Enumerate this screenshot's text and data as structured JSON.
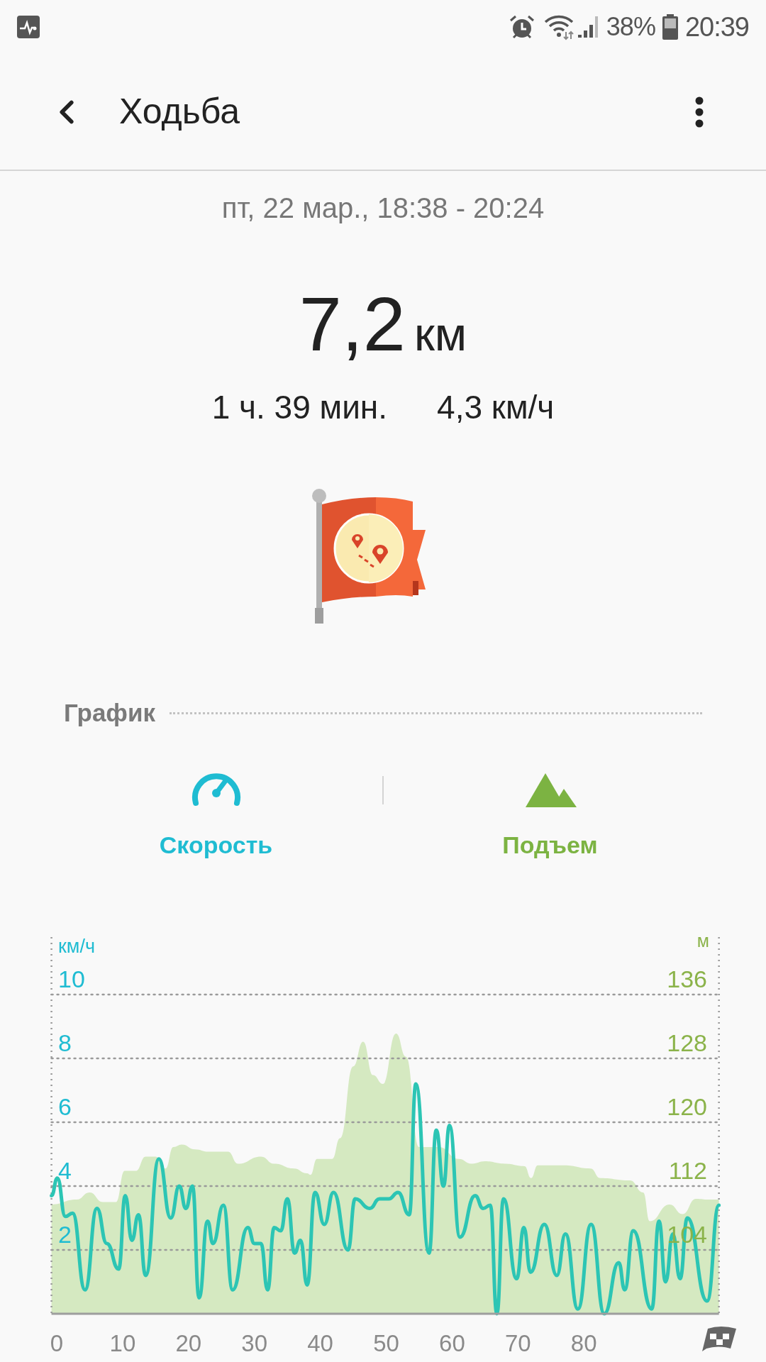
{
  "status_bar": {
    "battery": "38%",
    "time": "20:39"
  },
  "header": {
    "title": "Ходьба"
  },
  "workout": {
    "date": "пт, 22 мар., 18:38 - 20:24",
    "distance_value": "7,2",
    "distance_unit": "км",
    "duration": "1 ч. 39 мин.",
    "avg_speed": "4,3 км/ч"
  },
  "chart_section": {
    "title": "График",
    "toggles": [
      {
        "kind": "speed",
        "label": "Скорость",
        "color": "#1fbcd2"
      },
      {
        "kind": "elevation",
        "label": "Подъем",
        "color": "#7cb342"
      }
    ],
    "chart_data": {
      "type": "line",
      "grid": true,
      "ylabel": "км/ч",
      "y2label": "м",
      "xlim": [
        -0.8,
        100.5
      ],
      "ylim": [
        0,
        11.8
      ],
      "y2lim": [
        96,
        143.2
      ],
      "xticks": [
        0,
        10,
        20,
        30,
        40,
        50,
        60,
        70,
        80
      ],
      "yticks": [
        2,
        4,
        6,
        8,
        10
      ],
      "y2ticks": [
        104,
        112,
        120,
        128,
        136
      ],
      "series": [
        {
          "type": "area",
          "axis": "y2",
          "color": "#d5e9c1",
          "x": [
            -0.8,
            3,
            5,
            7,
            9,
            10.3,
            12,
            13.5,
            15,
            16.5,
            17.7,
            19,
            21,
            23,
            26,
            27.5,
            31,
            33,
            36,
            38,
            38.5,
            39.5,
            41.8,
            43,
            45,
            46.5,
            48,
            49.5,
            51.5,
            53,
            55,
            58,
            61,
            63,
            65,
            68,
            71,
            72,
            73,
            77,
            81,
            82.5,
            87,
            89,
            90,
            93,
            95,
            97,
            99,
            100.5
          ],
          "values": [
            109.7,
            110.3,
            111.2,
            110,
            110,
            113.9,
            113.9,
            115.7,
            115.7,
            114.2,
            116.9,
            117.2,
            116.6,
            116.3,
            116.3,
            114.8,
            115.7,
            114.8,
            114.2,
            113.6,
            113.4,
            115.4,
            115.4,
            118,
            127,
            130.1,
            125.9,
            124.8,
            131.1,
            128.2,
            116.9,
            116.9,
            115.4,
            114.8,
            115.1,
            114.8,
            114.5,
            113,
            114.6,
            114.6,
            114.2,
            113,
            112.7,
            111.2,
            107.6,
            109.7,
            108.5,
            110.4,
            110.3,
            110.3
          ]
        },
        {
          "type": "line",
          "color": "#2cc5b4",
          "x": [
            -0.8,
            0.1,
            1.3,
            2.4,
            4.3,
            6.1,
            7.6,
            9.4,
            10.4,
            11.4,
            12.4,
            13.5,
            15.5,
            17.3,
            18.6,
            19.6,
            20.6,
            21.6,
            22.9,
            23.7,
            25.3,
            26.7,
            29,
            30,
            31,
            32,
            33,
            34,
            35,
            36.1,
            37,
            38,
            39.2,
            40.6,
            42,
            44.2,
            45.3,
            47.5,
            49,
            50.4,
            51.8,
            53.5,
            54.5,
            56.5,
            57.6,
            58.7,
            59.6,
            61.2,
            63.5,
            64.7,
            65.8,
            66.8,
            67.8,
            69.8,
            70.9,
            71.9,
            74,
            75.9,
            77.2,
            79.1,
            81.1,
            83.1,
            85.3,
            86.2,
            87.5,
            90.3,
            91.4,
            92.4,
            93.5,
            94.6,
            95.7,
            98.7,
            100.5
          ],
          "values": [
            3.7,
            4.25,
            3.05,
            3.15,
            0.75,
            3.3,
            2.2,
            1.4,
            3.7,
            2.3,
            3.1,
            1.2,
            4.85,
            3.0,
            4.0,
            3.3,
            4.0,
            0.5,
            2.9,
            2.2,
            3.4,
            0.75,
            2.7,
            2.2,
            2.2,
            0.75,
            2.7,
            2.6,
            3.6,
            1.9,
            2.3,
            0.9,
            3.8,
            2.8,
            3.8,
            2.0,
            3.6,
            3.3,
            3.6,
            3.6,
            3.8,
            3.1,
            7.2,
            1.9,
            5.75,
            4.0,
            5.9,
            2.4,
            3.7,
            3.3,
            3.4,
            0,
            3.6,
            1.1,
            2.7,
            1.3,
            2.8,
            1.2,
            2.5,
            0.15,
            2.8,
            0,
            1.6,
            0.75,
            2.6,
            0.15,
            2.9,
            1.0,
            2.5,
            1.1,
            3.0,
            0.4,
            3.4
          ]
        }
      ]
    }
  }
}
